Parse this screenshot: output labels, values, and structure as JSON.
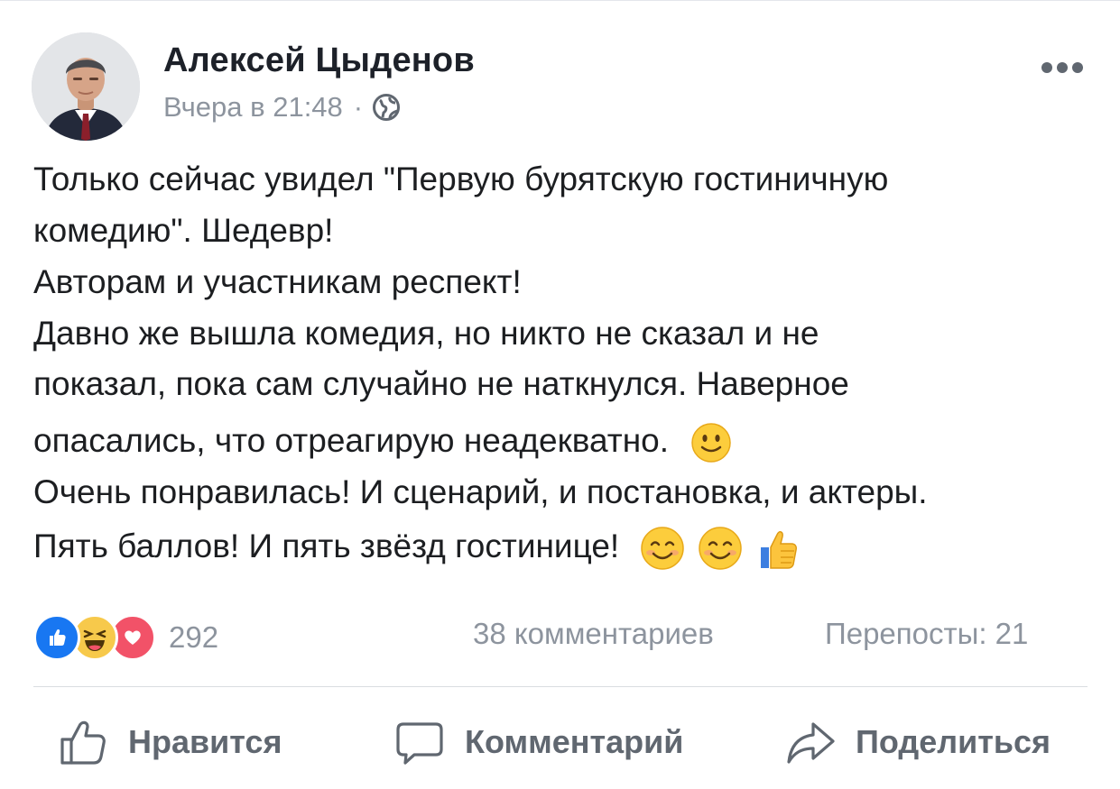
{
  "post": {
    "author": "Алексей Цыденов",
    "time": "Вчера в 21:48",
    "separator": "·",
    "lines": [
      "Только сейчас увидел \"Первую бурятскую гостиничную",
      "комедию\". Шедевр!",
      "Авторам и участникам респект!",
      "Давно же вышла комедия, но никто не сказал и не",
      "показал, пока сам случайно не наткнулся. Наверное",
      "опасались, что отреагирую неадекватно.",
      "Очень понравилась! И сценарий, и постановка, и актеры.",
      "Пять баллов! И пять звёзд гостинице!"
    ]
  },
  "icons": {
    "more": "more-options-icon",
    "privacy": "globe-icon",
    "slight_smile": "slightly-smiling-face-emoji",
    "smile": "smiling-face-emoji",
    "thumbs_up": "thumbs-up-emoji",
    "like": "like-thumb-icon",
    "comment": "comment-bubble-icon",
    "share": "share-arrow-icon"
  },
  "stats": {
    "reactions": [
      "like",
      "haha",
      "love"
    ],
    "reactions_count": "292",
    "comments": "38 комментариев",
    "shares": "Перепосты: 21"
  },
  "actions": {
    "like": "Нравится",
    "comment": "Комментарий",
    "share": "Поделиться"
  },
  "colors": {
    "text": "#1c1e21",
    "secondary": "#8d949e",
    "action": "#606770",
    "like_blue": "#1877f2",
    "love_red": "#f25268",
    "haha_yellow": "#f7c94b"
  }
}
